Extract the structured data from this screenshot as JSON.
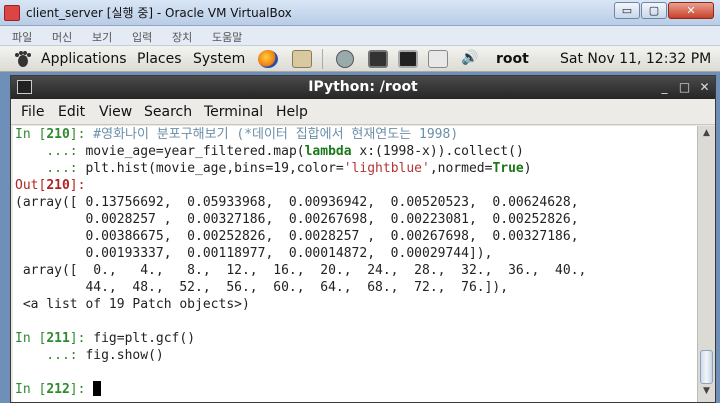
{
  "vbox": {
    "title": "client_server [실행 중] - Oracle VM VirtualBox",
    "menu": [
      "파일",
      "머신",
      "보기",
      "입력",
      "장치",
      "도움말"
    ],
    "buttons": {
      "minimize": "▭",
      "maximize": "▢",
      "close": "✕"
    }
  },
  "panel": {
    "menus": [
      "Applications",
      "Places",
      "System"
    ],
    "user": "root",
    "clock": "Sat Nov 11, 12:32 PM",
    "icons": [
      "gnome-foot-icon",
      "firefox-icon",
      "mail-icon",
      "network-icon",
      "display-icon",
      "terminal-icon",
      "text-editor-icon",
      "speaker-icon"
    ]
  },
  "terminal": {
    "title": "IPython: /root",
    "menu": [
      "File",
      "Edit",
      "View",
      "Search",
      "Terminal",
      "Help"
    ],
    "buttons": {
      "minimize": "_",
      "maximize": "□",
      "close": "✕"
    }
  },
  "session": {
    "in210": {
      "prompt": "In [",
      "num": "210",
      "close": "]: ",
      "comment": "#영화나이 분포구해보기 (*데이터 집합에서 현재연도는 1998)"
    },
    "cont1": {
      "prompt": "    ...: ",
      "code_a": "movie_age=year_filtered.map(",
      "kw": "lambda",
      "code_b": " x:(1998-x)).collect()"
    },
    "cont2": {
      "prompt": "    ...: ",
      "code_a": "plt.hist(movie_age,bins=19,color=",
      "str": "'lightblue'",
      "code_b": ",normed=",
      "kw": "True",
      "code_c": ")"
    },
    "out210": {
      "prompt": "Out[",
      "num": "210",
      "close": "]:"
    },
    "output": [
      "(array([ 0.13756692,  0.05933968,  0.00936942,  0.00520523,  0.00624628,",
      "         0.0028257 ,  0.00327186,  0.00267698,  0.00223081,  0.00252826,",
      "         0.00386675,  0.00252826,  0.0028257 ,  0.00267698,  0.00327186,",
      "         0.00193337,  0.00118977,  0.00014872,  0.00029744]),",
      " array([  0.,   4.,   8.,  12.,  16.,  20.,  24.,  28.,  32.,  36.,  40.,",
      "         44.,  48.,  52.,  56.,  60.,  64.,  68.,  72.,  76.]),",
      " <a list of 19 Patch objects>)"
    ],
    "in211": {
      "prompt": "In [",
      "num": "211",
      "close": "]: ",
      "code": "fig=plt.gcf()"
    },
    "cont3": {
      "prompt": "    ...: ",
      "code": "fig.show()"
    },
    "in212": {
      "prompt": "In [",
      "num": "212",
      "close": "]: "
    }
  }
}
